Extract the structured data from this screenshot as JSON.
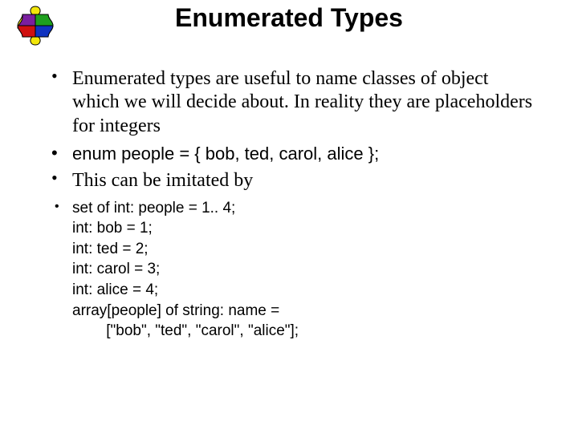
{
  "title": "Enumerated Types",
  "bullets": {
    "b1": "Enumerated types are useful to name classes of object which we will decide about. In reality they are placeholders for integers",
    "b2": "enum people = { bob, ted, carol, alice };",
    "b3": "This can be imitated by",
    "code": {
      "l1": "set of int: people = 1.. 4;",
      "l2": "int: bob = 1;",
      "l3": "int: ted = 2;",
      "l4": "int: carol = 3;",
      "l5": "int: alice = 4;",
      "l6": "array[people] of string: name =",
      "l7": "        [\"bob\", \"ted\", \"carol\", \"alice\"];"
    }
  }
}
